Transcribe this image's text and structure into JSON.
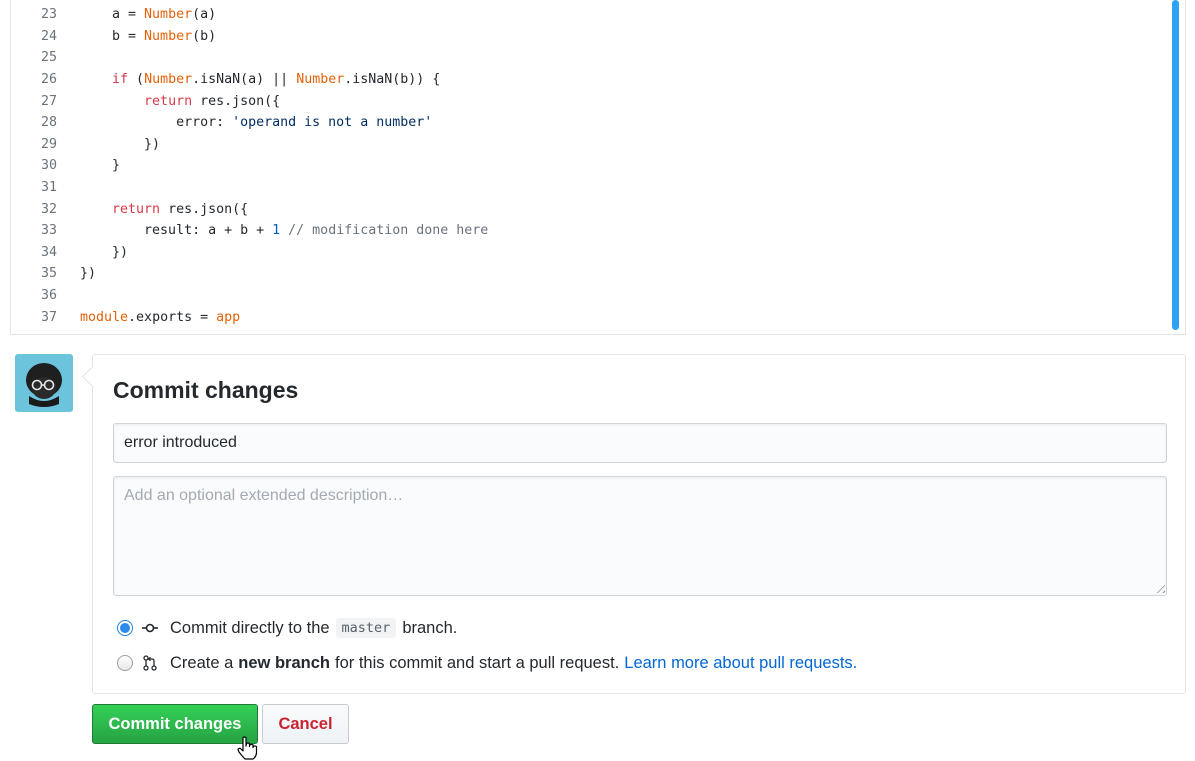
{
  "editor": {
    "lines": [
      {
        "n": "23",
        "tokens": [
          {
            "t": "    a = ",
            "c": ""
          },
          {
            "t": "Number",
            "c": "ty"
          },
          {
            "t": "(a)",
            "c": ""
          }
        ]
      },
      {
        "n": "24",
        "tokens": [
          {
            "t": "    b = ",
            "c": ""
          },
          {
            "t": "Number",
            "c": "ty"
          },
          {
            "t": "(b)",
            "c": ""
          }
        ]
      },
      {
        "n": "25",
        "tokens": []
      },
      {
        "n": "26",
        "tokens": [
          {
            "t": "    ",
            "c": ""
          },
          {
            "t": "if",
            "c": "kw"
          },
          {
            "t": " (",
            "c": ""
          },
          {
            "t": "Number",
            "c": "ty"
          },
          {
            "t": ".isNaN(a) || ",
            "c": ""
          },
          {
            "t": "Number",
            "c": "ty"
          },
          {
            "t": ".isNaN(b)) {",
            "c": ""
          }
        ]
      },
      {
        "n": "27",
        "tokens": [
          {
            "t": "        ",
            "c": ""
          },
          {
            "t": "return",
            "c": "kw"
          },
          {
            "t": " res.json({",
            "c": ""
          }
        ]
      },
      {
        "n": "28",
        "tokens": [
          {
            "t": "            error: ",
            "c": ""
          },
          {
            "t": "'operand is not a number'",
            "c": "str"
          }
        ]
      },
      {
        "n": "29",
        "tokens": [
          {
            "t": "        })",
            "c": ""
          }
        ]
      },
      {
        "n": "30",
        "tokens": [
          {
            "t": "    }",
            "c": ""
          }
        ]
      },
      {
        "n": "31",
        "tokens": []
      },
      {
        "n": "32",
        "tokens": [
          {
            "t": "    ",
            "c": ""
          },
          {
            "t": "return",
            "c": "kw"
          },
          {
            "t": " res.json({",
            "c": ""
          }
        ]
      },
      {
        "n": "33",
        "tokens": [
          {
            "t": "        result: a + b + ",
            "c": ""
          },
          {
            "t": "1",
            "c": "num"
          },
          {
            "t": " // modification done here",
            "c": "cm"
          }
        ]
      },
      {
        "n": "34",
        "tokens": [
          {
            "t": "    })",
            "c": ""
          }
        ]
      },
      {
        "n": "35",
        "tokens": [
          {
            "t": "})",
            "c": ""
          }
        ]
      },
      {
        "n": "36",
        "tokens": []
      },
      {
        "n": "37",
        "tokens": [
          {
            "t": "module",
            "c": "ty"
          },
          {
            "t": ".exports = ",
            "c": ""
          },
          {
            "t": "app",
            "c": "ty"
          }
        ]
      }
    ]
  },
  "commit": {
    "title": "Commit changes",
    "summary_value": "error introduced",
    "description_placeholder": "Add an optional extended description…",
    "option_direct": {
      "prefix": "Commit directly to the",
      "branch": "master",
      "suffix": "branch.",
      "checked": true
    },
    "option_new_branch": {
      "prefix": "Create a",
      "bold": "new branch",
      "suffix": "for this commit and start a pull request.",
      "link": "Learn more about pull requests.",
      "checked": false
    }
  },
  "buttons": {
    "commit_label": "Commit changes",
    "cancel_label": "Cancel"
  },
  "colors": {
    "accent_blue": "#0366d6",
    "commit_green": "#28a745",
    "cancel_red": "#cb2431"
  }
}
